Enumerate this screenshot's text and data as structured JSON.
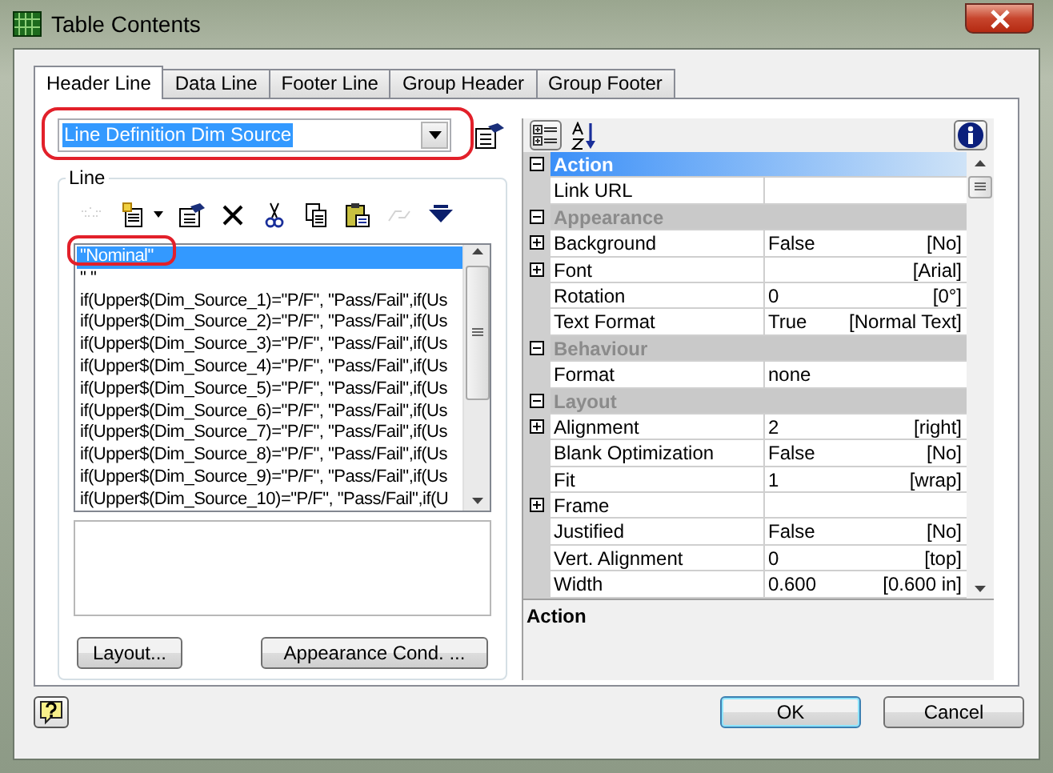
{
  "window": {
    "title": "Table Contents"
  },
  "tabs": [
    {
      "label": "Header Line",
      "selected": true
    },
    {
      "label": "Data Line",
      "selected": false
    },
    {
      "label": "Footer Line",
      "selected": false
    },
    {
      "label": "Group Header",
      "selected": false
    },
    {
      "label": "Group Footer",
      "selected": false
    }
  ],
  "line_definition": {
    "value": "Line Definition Dim Source"
  },
  "line_group": {
    "label": "Line",
    "toolbar": [
      {
        "kind": "wrap",
        "disabled": true
      },
      {
        "kind": "insert",
        "disabled": false
      },
      {
        "kind": "properties",
        "disabled": false
      },
      {
        "kind": "delete",
        "disabled": false
      },
      {
        "kind": "cut",
        "disabled": false
      },
      {
        "kind": "copy",
        "disabled": false
      },
      {
        "kind": "paste",
        "disabled": false
      },
      {
        "kind": "join",
        "disabled": true
      },
      {
        "kind": "move-down",
        "disabled": false
      }
    ],
    "list_items": [
      {
        "text": "\"Nominal\"",
        "selected": true
      },
      {
        "text": "\" \"",
        "selected": false
      },
      {
        "text": "if(Upper$(Dim_Source_1)=\"P/F\", \"Pass/Fail\",if(Us",
        "selected": false
      },
      {
        "text": "if(Upper$(Dim_Source_2)=\"P/F\", \"Pass/Fail\",if(Us",
        "selected": false
      },
      {
        "text": "if(Upper$(Dim_Source_3)=\"P/F\", \"Pass/Fail\",if(Us",
        "selected": false
      },
      {
        "text": "if(Upper$(Dim_Source_4)=\"P/F\", \"Pass/Fail\",if(Us",
        "selected": false
      },
      {
        "text": "if(Upper$(Dim_Source_5)=\"P/F\", \"Pass/Fail\",if(Us",
        "selected": false
      },
      {
        "text": "if(Upper$(Dim_Source_6)=\"P/F\", \"Pass/Fail\",if(Us",
        "selected": false
      },
      {
        "text": "if(Upper$(Dim_Source_7)=\"P/F\", \"Pass/Fail\",if(Us",
        "selected": false
      },
      {
        "text": "if(Upper$(Dim_Source_8)=\"P/F\", \"Pass/Fail\",if(Us",
        "selected": false
      },
      {
        "text": "if(Upper$(Dim_Source_9)=\"P/F\", \"Pass/Fail\",if(Us",
        "selected": false
      },
      {
        "text": "if(Upper$(Dim_Source_10)=\"P/F\", \"Pass/Fail\",if(U",
        "selected": false
      }
    ],
    "buttons": [
      "Layout...",
      "Appearance Cond. ..."
    ]
  },
  "properties": {
    "rows": [
      {
        "kind": "category",
        "label": "Action",
        "expanded": true,
        "selected": true
      },
      {
        "kind": "item",
        "name": "Link URL",
        "expandable": false
      },
      {
        "kind": "category",
        "label": "Appearance",
        "expanded": true,
        "selected": false
      },
      {
        "kind": "item",
        "name": "Background",
        "value": "False",
        "display": "[No]",
        "expandable": true
      },
      {
        "kind": "item",
        "name": "Font",
        "display": "[Arial]",
        "expandable": true
      },
      {
        "kind": "item",
        "name": "Rotation",
        "value": "0",
        "display": "[0°]",
        "expandable": false
      },
      {
        "kind": "item",
        "name": "Text Format",
        "value": "True",
        "display": "[Normal Text]",
        "expandable": false
      },
      {
        "kind": "category",
        "label": "Behaviour",
        "expanded": true,
        "selected": false
      },
      {
        "kind": "item",
        "name": "Format",
        "value": "none",
        "expandable": false
      },
      {
        "kind": "category",
        "label": "Layout",
        "expanded": true,
        "selected": false
      },
      {
        "kind": "item",
        "name": "Alignment",
        "value": "2",
        "display": "[right]",
        "expandable": true
      },
      {
        "kind": "item",
        "name": "Blank Optimization",
        "value": "False",
        "display": "[No]",
        "expandable": false
      },
      {
        "kind": "item",
        "name": "Fit",
        "value": "1",
        "display": "[wrap]",
        "expandable": false
      },
      {
        "kind": "item",
        "name": "Frame",
        "expandable": true
      },
      {
        "kind": "item",
        "name": "Justified",
        "value": "False",
        "display": "[No]",
        "expandable": false
      },
      {
        "kind": "item",
        "name": "Vert. Alignment",
        "value": "0",
        "display": "[top]",
        "expandable": false
      },
      {
        "kind": "item",
        "name": "Width",
        "value": "0.600",
        "display": "[0.600 in]",
        "expandable": false
      }
    ],
    "description": "Action"
  },
  "dialog_buttons": [
    {
      "label": "OK",
      "default": true
    },
    {
      "label": "Cancel",
      "default": false
    }
  ]
}
